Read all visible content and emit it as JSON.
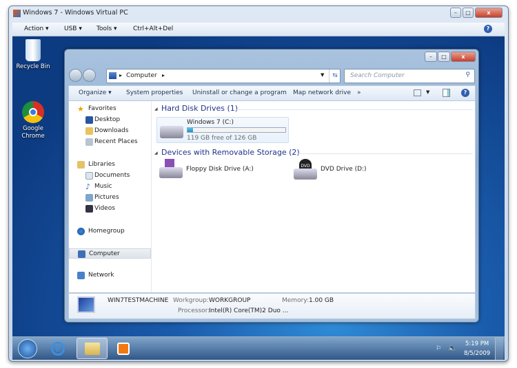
{
  "host": {
    "title": "Windows 7 - Windows Virtual PC",
    "menu": [
      "Action ▾",
      "USB ▾",
      "Tools ▾",
      "Ctrl+Alt+Del"
    ],
    "help": "?"
  },
  "desktop": {
    "icons": [
      {
        "label": "Recycle Bin"
      },
      {
        "label": "Google Chrome"
      }
    ]
  },
  "explorer": {
    "breadcrumb": "Computer",
    "search_placeholder": "Search Computer",
    "toolbar": [
      "Organize ▾",
      "System properties",
      "Uninstall or change a program",
      "Map network drive",
      "»"
    ],
    "nav": {
      "favorites": "Favorites",
      "fav_items": [
        "Desktop",
        "Downloads",
        "Recent Places"
      ],
      "libraries": "Libraries",
      "lib_items": [
        "Documents",
        "Music",
        "Pictures",
        "Videos"
      ],
      "homegroup": "Homegroup",
      "computer": "Computer",
      "network": "Network"
    },
    "sections": {
      "hdd": "Hard Disk Drives (1)",
      "removable": "Devices with Removable Storage (2)"
    },
    "drive_c": {
      "name": "Windows 7 (C:)",
      "free": "119 GB free of 126 GB",
      "used_fraction": 0.056
    },
    "floppy": "Floppy Disk Drive (A:)",
    "dvd": "DVD Drive (D:)",
    "dvd_badge": "DVD",
    "details": {
      "machine": "WIN7TESTMACHINE",
      "workgroup_label": "Workgroup:",
      "workgroup": "WORKGROUP",
      "memory_label": "Memory:",
      "memory": "1.00 GB",
      "processor_label": "Processor:",
      "processor": "Intel(R) Core(TM)2 Duo ..."
    }
  },
  "taskbar": {
    "time": "5:19 PM",
    "date": "8/5/2009"
  }
}
